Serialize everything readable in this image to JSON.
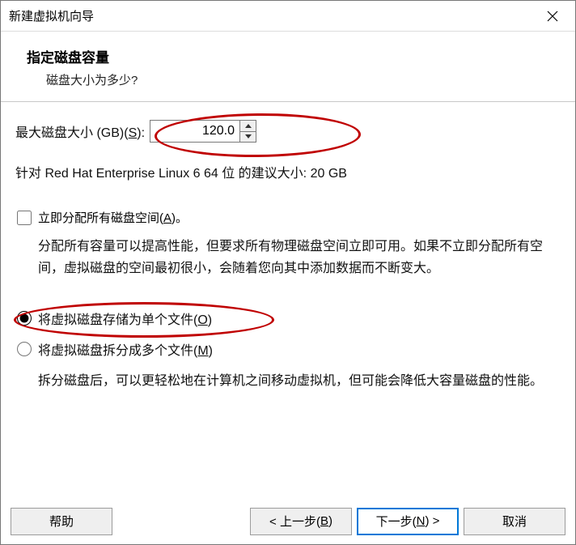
{
  "title": "新建虚拟机向导",
  "header": {
    "heading": "指定磁盘容量",
    "subtitle": "磁盘大小为多少?"
  },
  "disk": {
    "label_pre": "最大磁盘大小 (GB)(",
    "label_accel": "S",
    "label_post": "):",
    "value": "120.0",
    "recommend": "针对 Red Hat Enterprise Linux 6 64 位 的建议大小: 20 GB"
  },
  "allocate": {
    "label_pre": "立即分配所有磁盘空间(",
    "label_accel": "A",
    "label_post": ")。",
    "checked": false,
    "desc": "分配所有容量可以提高性能，但要求所有物理磁盘空间立即可用。如果不立即分配所有空间，虚拟磁盘的空间最初很小，会随着您向其中添加数据而不断变大。"
  },
  "store": {
    "single_pre": "将虚拟磁盘存储为单个文件(",
    "single_accel": "O",
    "single_post": ")",
    "multi_pre": "将虚拟磁盘拆分成多个文件(",
    "multi_accel": "M",
    "multi_post": ")",
    "selected": "single",
    "desc": "拆分磁盘后，可以更轻松地在计算机之间移动虚拟机，但可能会降低大容量磁盘的性能。"
  },
  "buttons": {
    "help": "帮助",
    "back_pre": "< 上一步(",
    "back_accel": "B",
    "back_post": ")",
    "next_pre": "下一步(",
    "next_accel": "N",
    "next_post": ") >",
    "cancel": "取消"
  }
}
